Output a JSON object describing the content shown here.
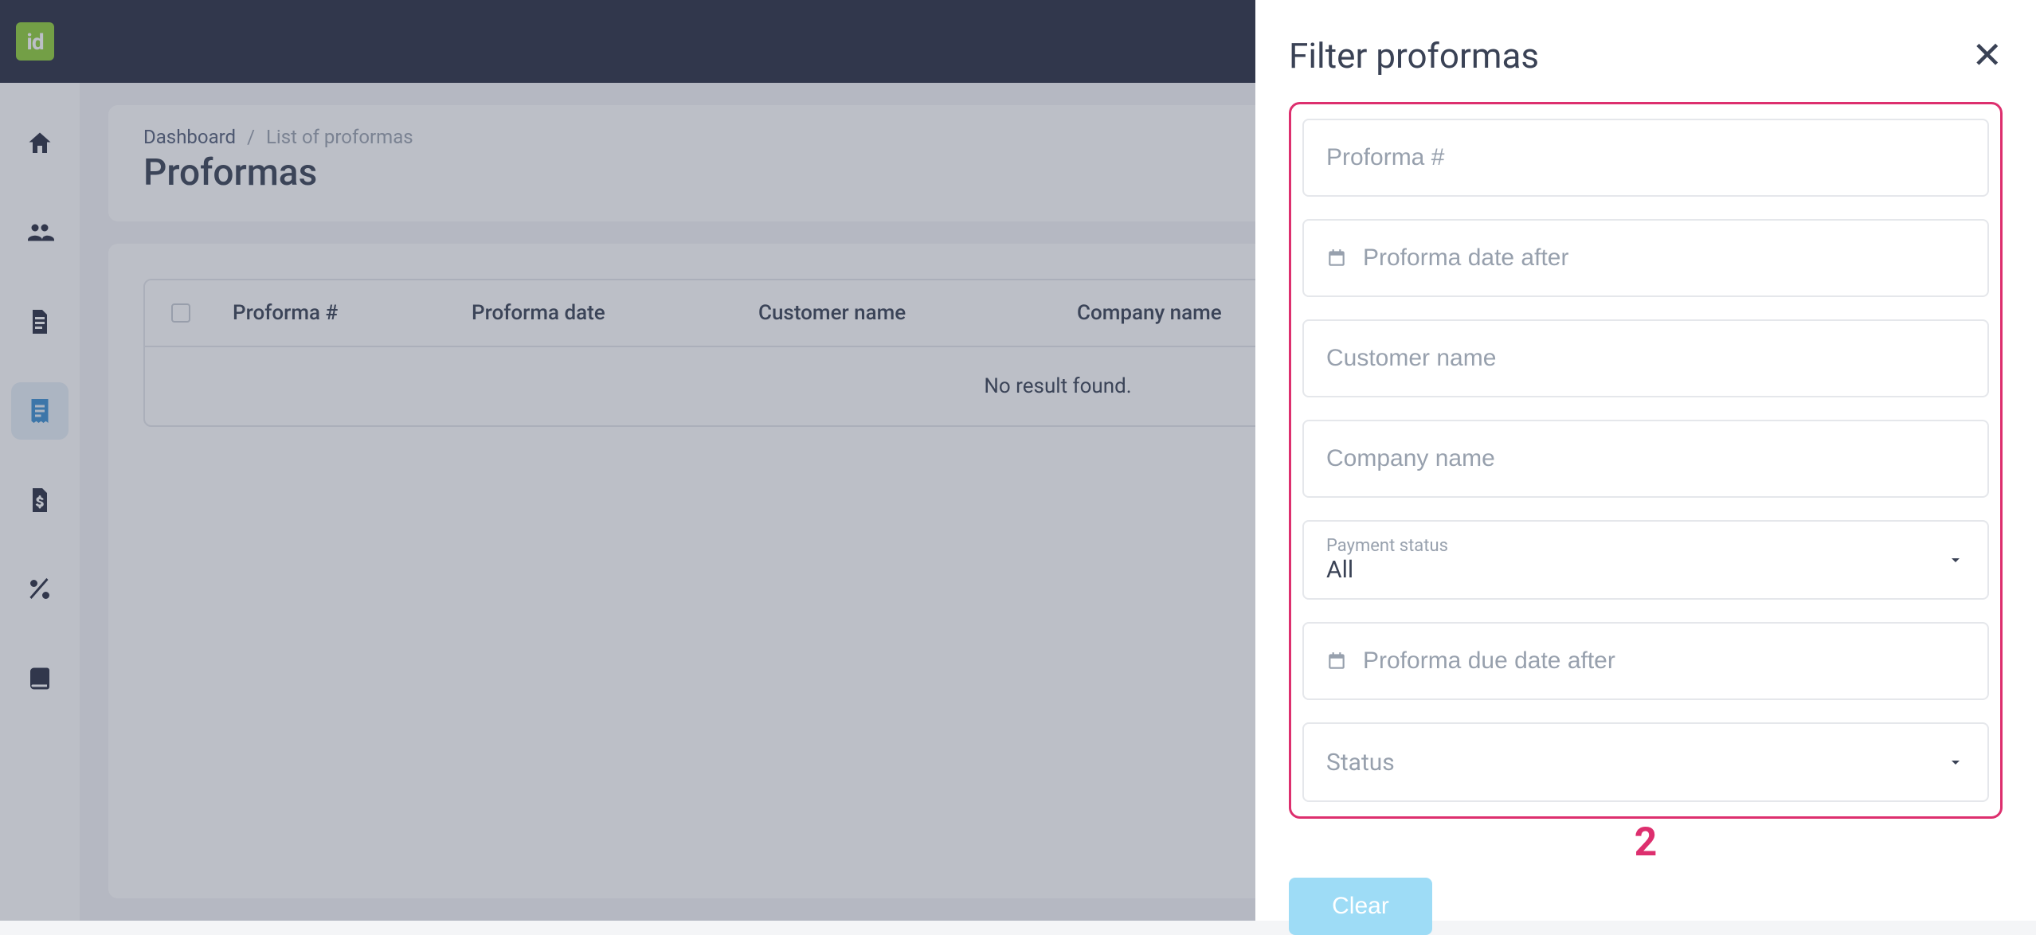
{
  "logo_text": "id",
  "sidebar": {
    "items": [
      {
        "name": "home"
      },
      {
        "name": "customers"
      },
      {
        "name": "documents"
      },
      {
        "name": "proformas",
        "active": true
      },
      {
        "name": "billing"
      },
      {
        "name": "discounts"
      },
      {
        "name": "ledger"
      }
    ]
  },
  "breadcrumb": {
    "root": "Dashboard",
    "sep": "/",
    "current": "List of proformas"
  },
  "page_title": "Proformas",
  "table": {
    "columns": [
      "Proforma #",
      "Proforma date",
      "Customer name",
      "Company name"
    ],
    "empty_message": "No result found."
  },
  "drawer": {
    "title": "Filter proformas",
    "fields": {
      "proforma_num_placeholder": "Proforma #",
      "date_after_placeholder": "Proforma date after",
      "customer_name_placeholder": "Customer name",
      "company_name_placeholder": "Company name",
      "payment_status_label": "Payment status",
      "payment_status_value": "All",
      "due_date_after_placeholder": "Proforma due date after",
      "status_placeholder": "Status"
    },
    "annotation": "2",
    "clear_label": "Clear"
  }
}
